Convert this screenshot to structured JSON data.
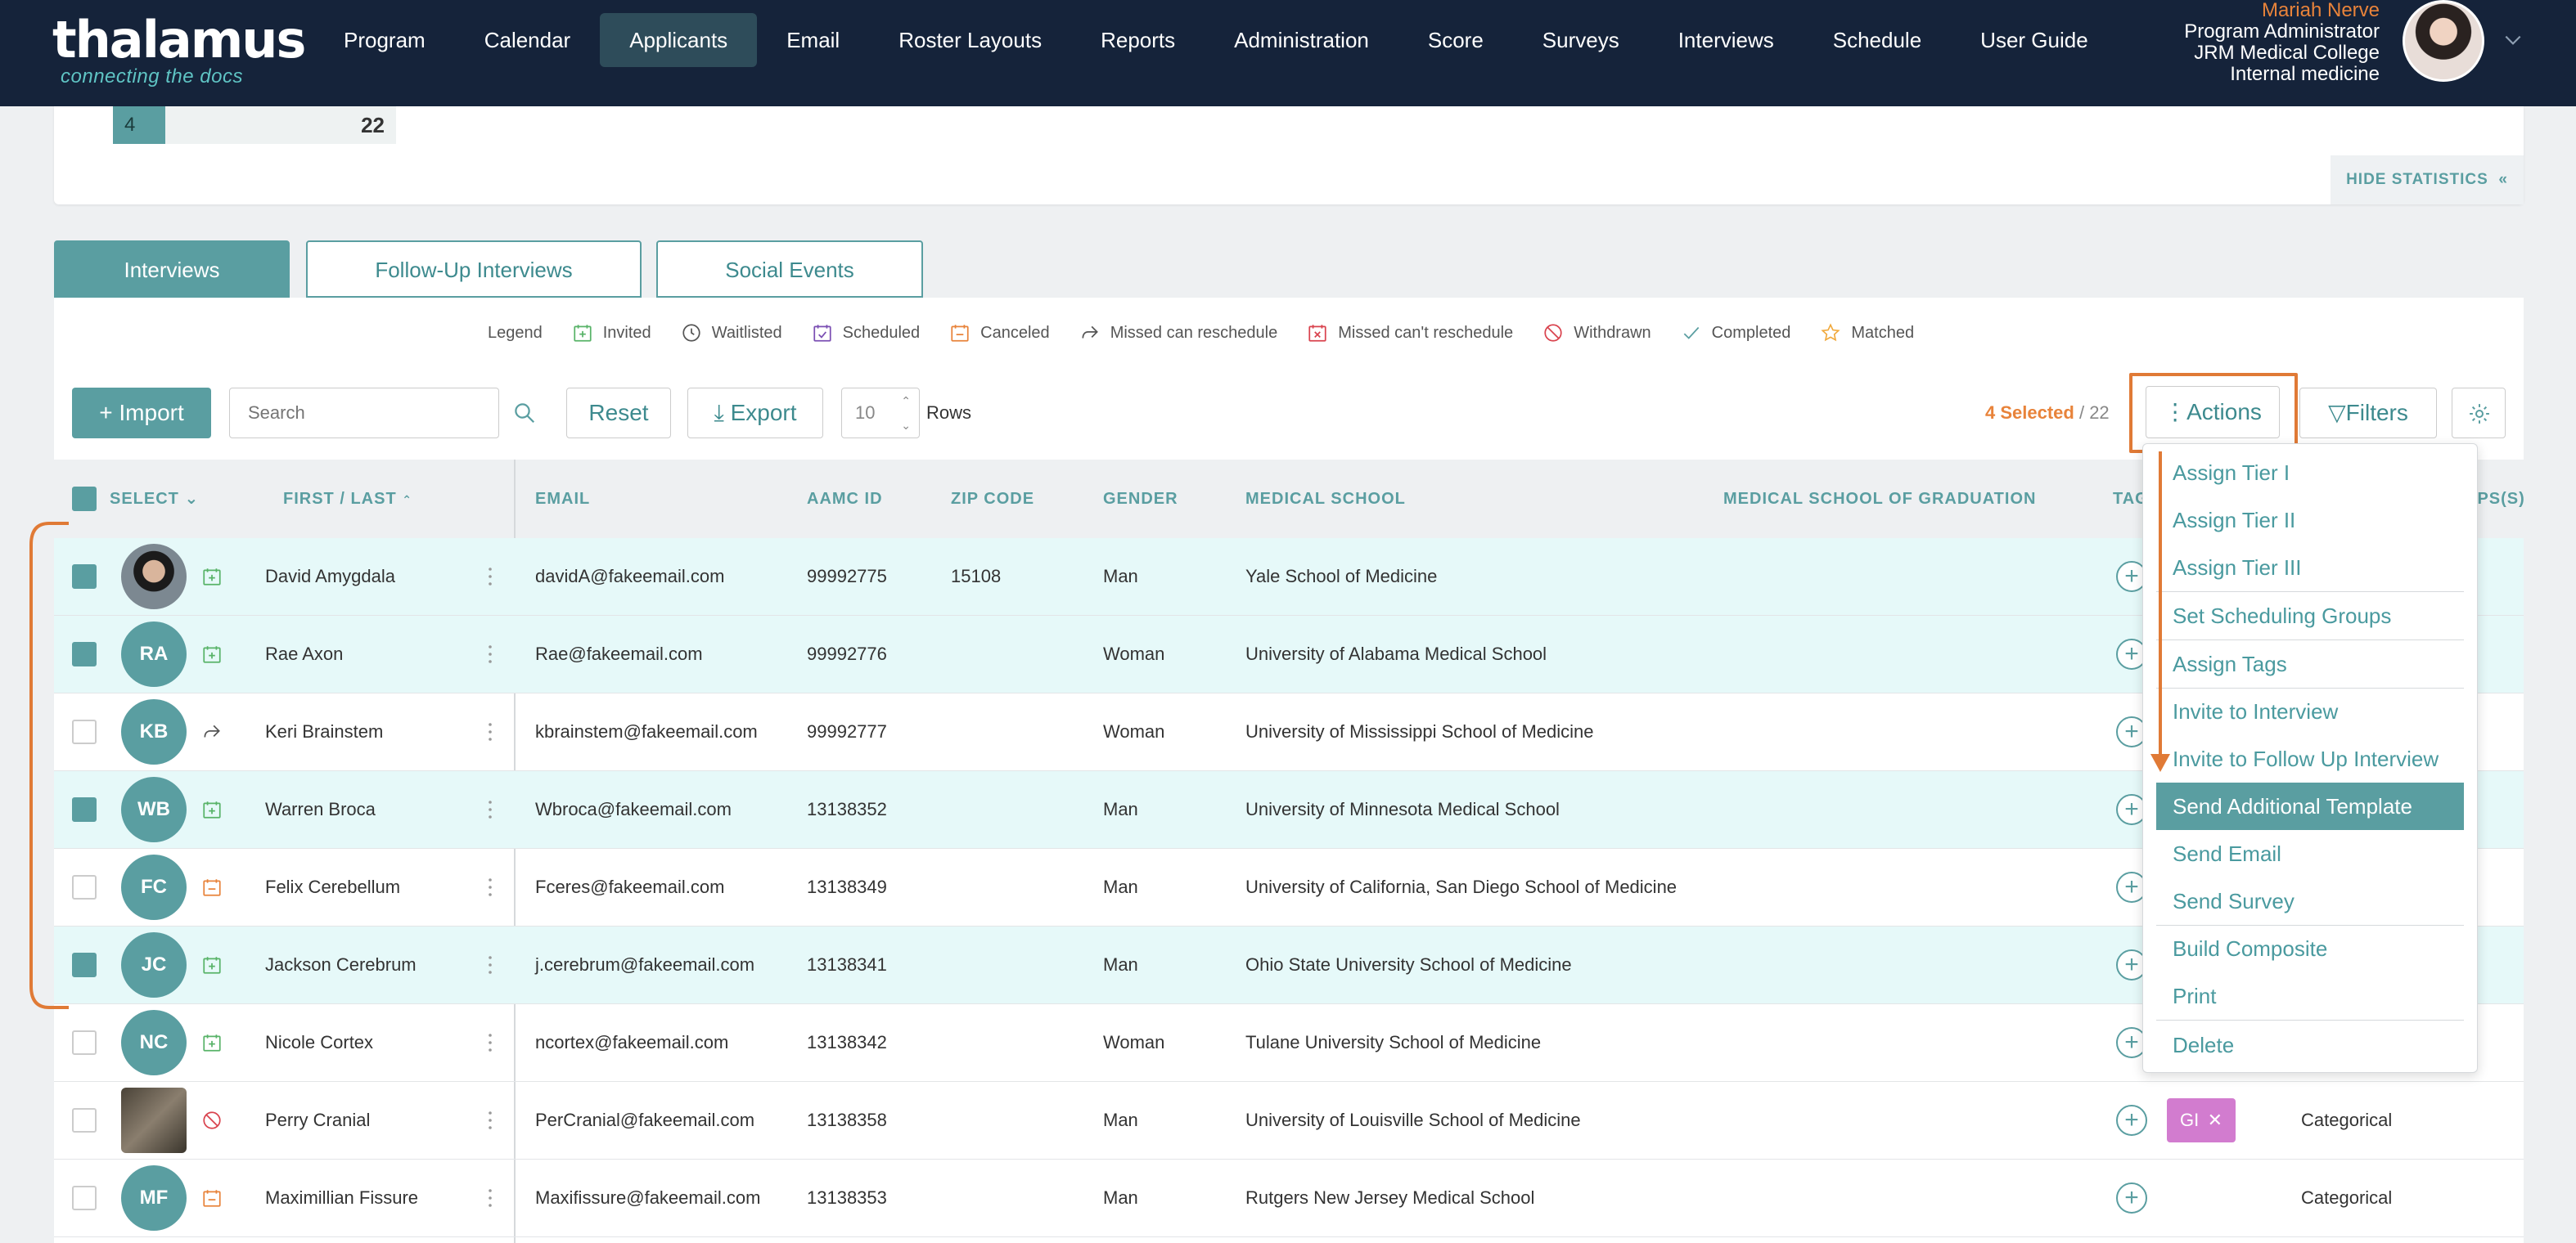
{
  "nav": {
    "logo_main": "thalamus",
    "logo_sub": "connecting the docs",
    "items": [
      "Program",
      "Calendar",
      "Applicants",
      "Email",
      "Roster Layouts",
      "Reports",
      "Administration",
      "Score",
      "Surveys",
      "Interviews",
      "Schedule",
      "User Guide"
    ],
    "active": "Applicants"
  },
  "user": {
    "name": "Mariah Nerve",
    "role": "Program Administrator",
    "institution": "JRM Medical College",
    "department": "Internal medicine"
  },
  "stats": {
    "left_value": "4",
    "right_value": "22",
    "hide_label": "HIDE STATISTICS"
  },
  "tabs": [
    "Interviews",
    "Follow-Up Interviews",
    "Social Events"
  ],
  "legend": {
    "title": "Legend",
    "items": [
      "Invited",
      "Waitlisted",
      "Scheduled",
      "Canceled",
      "Missed can reschedule",
      "Missed can't reschedule",
      "Withdrawn",
      "Completed",
      "Matched"
    ]
  },
  "toolbar": {
    "import_label": "Import",
    "search_placeholder": "Search",
    "reset_label": "Reset",
    "export_label": "Export",
    "rows_value": "10",
    "rows_label": "Rows",
    "selected_label": "4 Selected",
    "total_label": "/ 22",
    "actions_label": "Actions",
    "filters_label": "Filters"
  },
  "table": {
    "headers": {
      "select": "SELECT",
      "name": "FIRST / LAST",
      "email": "EMAIL",
      "aamc": "AAMC ID",
      "zip": "ZIP CODE",
      "gender": "GENDER",
      "school": "MEDICAL SCHOOL",
      "school_grad": "MEDICAL SCHOOL OF GRADUATION",
      "tags": "TAG",
      "groups": "UPS(S)"
    },
    "rows": [
      {
        "initials": "",
        "name": "David Amygdala",
        "email": "davidA@fakeemail.com",
        "aamc": "99992775",
        "zip": "15108",
        "gender": "Man",
        "school": "Yale School of Medicine",
        "extra": ""
      },
      {
        "initials": "RA",
        "name": "Rae Axon",
        "email": "Rae@fakeemail.com",
        "aamc": "99992776",
        "zip": "",
        "gender": "Woman",
        "school": "University of Alabama Medical School",
        "extra": ""
      },
      {
        "initials": "KB",
        "name": "Keri Brainstem",
        "email": "kbrainstem@fakeemail.com",
        "aamc": "99992777",
        "zip": "",
        "gender": "Woman",
        "school": "University of Mississippi School of Medicine",
        "extra": ""
      },
      {
        "initials": "WB",
        "name": "Warren Broca",
        "email": "Wbroca@fakeemail.com",
        "aamc": "13138352",
        "zip": "",
        "gender": "Man",
        "school": "University of Minnesota Medical School",
        "extra": ""
      },
      {
        "initials": "FC",
        "name": "Felix Cerebellum",
        "email": "Fceres@fakeemail.com",
        "aamc": "13138349",
        "zip": "",
        "gender": "Man",
        "school": "University of California, San Diego School of Medicine",
        "extra": ""
      },
      {
        "initials": "JC",
        "name": "Jackson Cerebrum",
        "email": "j.cerebrum@fakeemail.com",
        "aamc": "13138341",
        "zip": "",
        "gender": "Man",
        "school": "Ohio State University School of Medicine",
        "extra": ""
      },
      {
        "initials": "NC",
        "name": "Nicole Cortex",
        "email": "ncortex@fakeemail.com",
        "aamc": "13138342",
        "zip": "",
        "gender": "Woman",
        "school": "Tulane University School of Medicine",
        "extra": ""
      },
      {
        "initials": "",
        "name": "Perry Cranial",
        "email": "PerCranial@fakeemail.com",
        "aamc": "13138358",
        "zip": "",
        "gender": "Man",
        "school": "University of Louisville School of Medicine",
        "extra": "Categorical",
        "tag": "GI"
      },
      {
        "initials": "MF",
        "name": "Maximillian Fissure",
        "email": "Maxifissure@fakeemail.com",
        "aamc": "13138353",
        "zip": "",
        "gender": "Man",
        "school": "Rutgers New Jersey Medical School",
        "extra": "Categorical"
      }
    ]
  },
  "actions_menu": {
    "items": [
      "Assign Tier I",
      "Assign Tier II",
      "Assign Tier III",
      "Set Scheduling Groups",
      "Assign Tags",
      "Invite to Interview",
      "Invite to Follow Up Interview",
      "Send Additional Template",
      "Send Email",
      "Send Survey",
      "Build Composite",
      "Print",
      "Delete"
    ],
    "highlighted": "Send Additional Template"
  },
  "colors": {
    "nav_bg": "#15233a",
    "accent": "#5a9ea1",
    "orange": "#e8833a",
    "selected_row": "#e6f9f9"
  }
}
